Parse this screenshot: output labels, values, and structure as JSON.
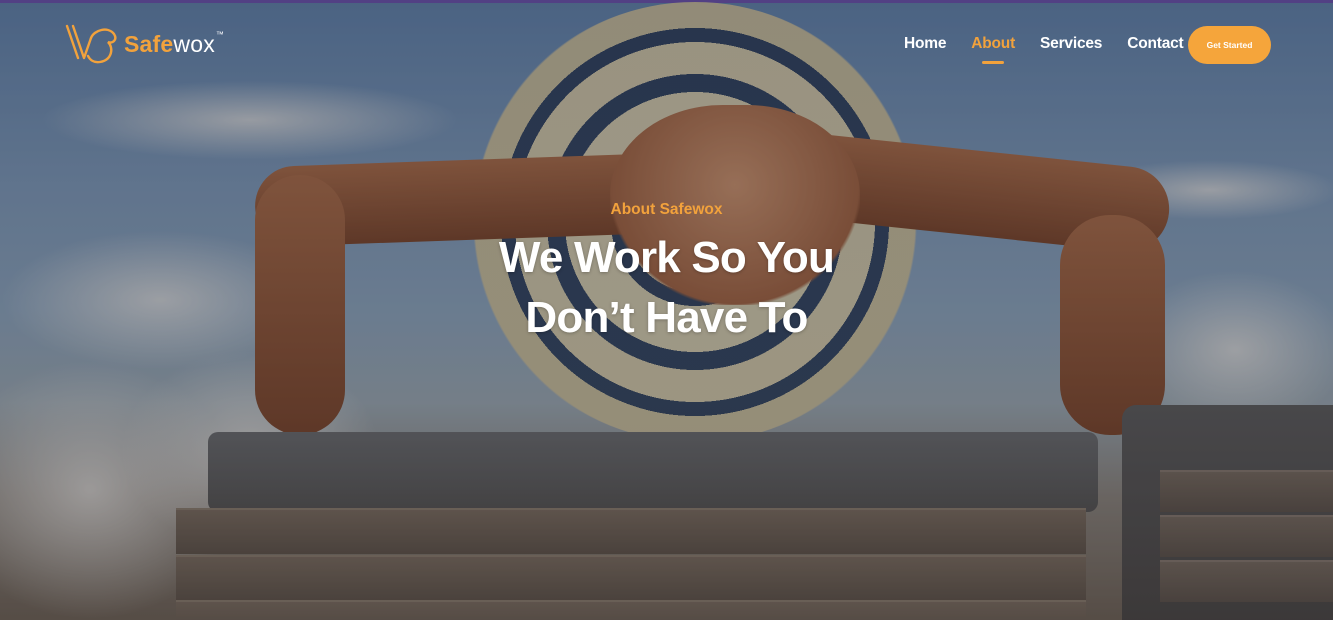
{
  "brand": {
    "name_highlight": "Safe",
    "name_rest": "wox",
    "trademark": "™"
  },
  "nav": {
    "items": [
      {
        "label": "Home",
        "active": false
      },
      {
        "label": "About",
        "active": true
      },
      {
        "label": "Services",
        "active": false
      },
      {
        "label": "Contact",
        "active": false
      }
    ],
    "cta_label": "Get Started"
  },
  "hero": {
    "eyebrow": "About Safewox",
    "headline_line1": "We Work So You",
    "headline_line2": "Don’t Have To"
  },
  "colors": {
    "accent": "#f2a23c",
    "text": "#ffffff"
  }
}
